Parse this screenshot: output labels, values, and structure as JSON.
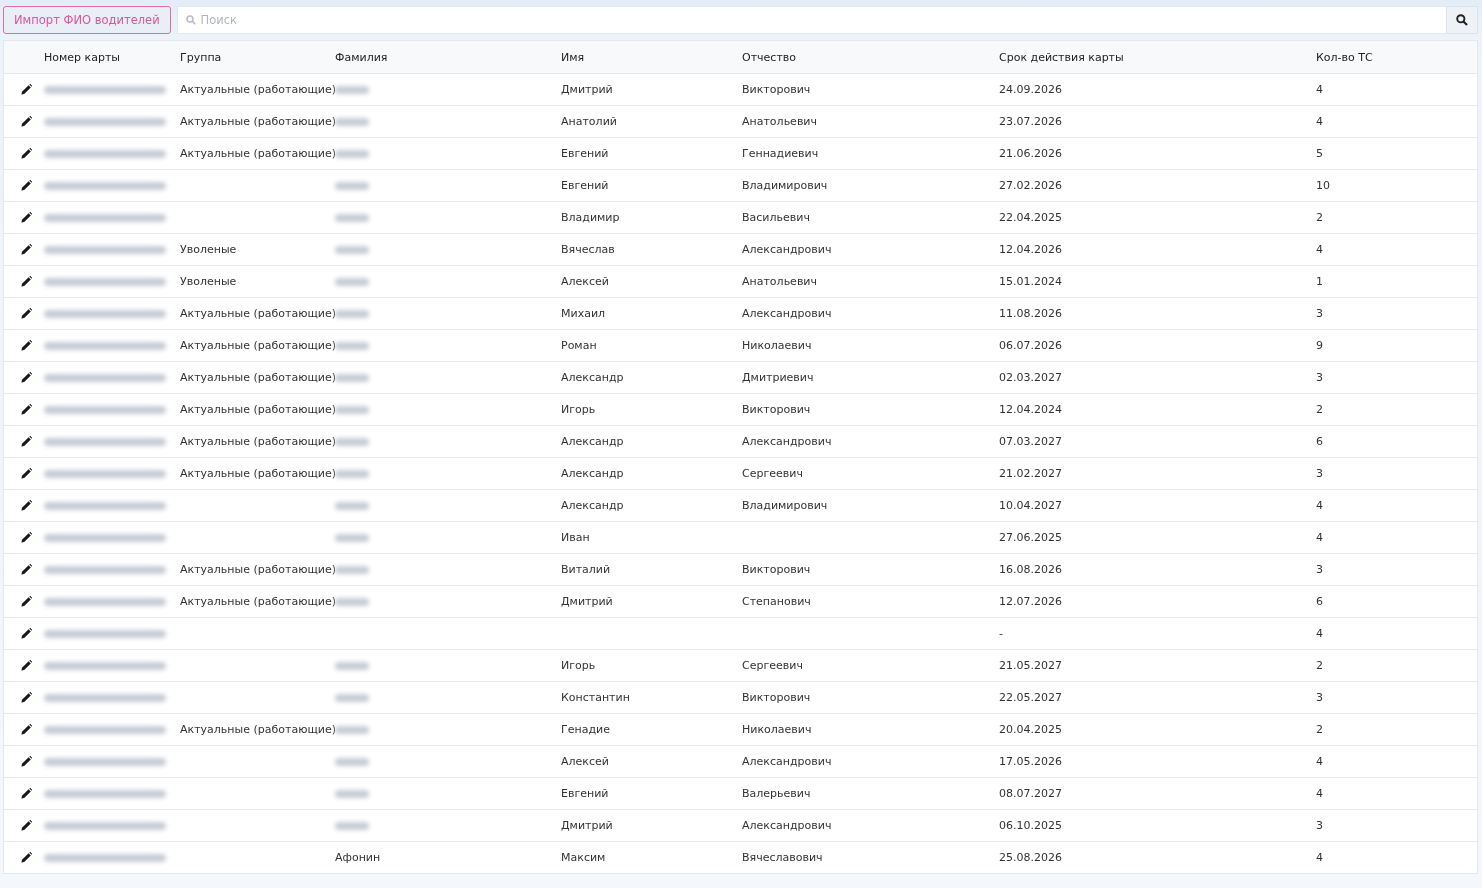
{
  "toolbar": {
    "import_button": "Импорт ФИО водителей",
    "search": {
      "placeholder": "Поиск"
    }
  },
  "table": {
    "columns": [
      "Номер карты",
      "Группа",
      "Фамилия",
      "Имя",
      "Отчество",
      "Срок действия карты",
      "Кол-во ТС"
    ],
    "rows": [
      {
        "card_redacted": true,
        "group": "Актуальные (работающие)",
        "surname_redacted": true,
        "name": "Дмитрий",
        "patronymic": "Викторович",
        "expires": "24.09.2026",
        "vehicles": "4"
      },
      {
        "card_redacted": true,
        "group": "Актуальные (работающие)",
        "surname_redacted": true,
        "name": "Анатолий",
        "patronymic": "Анатольевич",
        "expires": "23.07.2026",
        "vehicles": "4"
      },
      {
        "card_redacted": true,
        "group": "Актуальные (работающие)",
        "surname_redacted": true,
        "name": "Евгений",
        "patronymic": "Геннадиевич",
        "expires": "21.06.2026",
        "vehicles": "5"
      },
      {
        "card_redacted": true,
        "surname_redacted": true,
        "name": "Евгений",
        "patronymic": "Владимирович",
        "expires": "27.02.2026",
        "vehicles": "10"
      },
      {
        "card_redacted": true,
        "surname_redacted": true,
        "name": "Владимир",
        "patronymic": "Васильевич",
        "expires": "22.04.2025",
        "vehicles": "2"
      },
      {
        "card_redacted": true,
        "group": "Уволеные",
        "surname_redacted": true,
        "name": "Вячеслав",
        "patronymic": "Александрович",
        "expires": "12.04.2026",
        "vehicles": "4"
      },
      {
        "card_redacted": true,
        "group": "Уволеные",
        "surname_redacted": true,
        "name": "Алексей",
        "patronymic": "Анатольевич",
        "expires": "15.01.2024",
        "vehicles": "1"
      },
      {
        "card_redacted": true,
        "group": "Актуальные (работающие)",
        "surname_redacted": true,
        "name": "Михаил",
        "patronymic": "Александрович",
        "expires": "11.08.2026",
        "vehicles": "3"
      },
      {
        "card_redacted": true,
        "group": "Актуальные (работающие)",
        "surname_redacted": true,
        "name": "Роман",
        "patronymic": "Николаевич",
        "expires": "06.07.2026",
        "vehicles": "9"
      },
      {
        "card_redacted": true,
        "group": "Актуальные (работающие)",
        "surname_redacted": true,
        "name": "Александр",
        "patronymic": "Дмитриевич",
        "expires": "02.03.2027",
        "vehicles": "3"
      },
      {
        "card_redacted": true,
        "group": "Актуальные (работающие)",
        "surname_redacted": true,
        "name": "Игорь",
        "patronymic": "Викторович",
        "expires": "12.04.2024",
        "vehicles": "2"
      },
      {
        "card_redacted": true,
        "group": "Актуальные (работающие)",
        "surname_redacted": true,
        "name": "Александр",
        "patronymic": "Александрович",
        "expires": "07.03.2027",
        "vehicles": "6"
      },
      {
        "card_redacted": true,
        "group": "Актуальные (работающие)",
        "surname_redacted": true,
        "name": "Александр",
        "patronymic": "Сергеевич",
        "expires": "21.02.2027",
        "vehicles": "3"
      },
      {
        "card_redacted": true,
        "surname_redacted": true,
        "name": "Александр",
        "patronymic": "Владимирович",
        "expires": "10.04.2027",
        "vehicles": "4"
      },
      {
        "card_redacted": true,
        "surname_redacted": true,
        "name": "Иван",
        "expires": "27.06.2025",
        "vehicles": "4"
      },
      {
        "card_redacted": true,
        "group": "Актуальные (работающие)",
        "surname_redacted": true,
        "name": "Виталий",
        "patronymic": "Викторович",
        "expires": "16.08.2026",
        "vehicles": "3"
      },
      {
        "card_redacted": true,
        "group": "Актуальные (работающие)",
        "surname_redacted": true,
        "name": "Дмитрий",
        "patronymic": "Степанович",
        "expires": "12.07.2026",
        "vehicles": "6"
      },
      {
        "card_redacted": true,
        "expires": "-",
        "vehicles": "4"
      },
      {
        "card_redacted": true,
        "surname_redacted": true,
        "name": "Игорь",
        "patronymic": "Сергеевич",
        "expires": "21.05.2027",
        "vehicles": "2"
      },
      {
        "card_redacted": true,
        "surname_redacted": true,
        "name": "Константин",
        "patronymic": "Викторович",
        "expires": "22.05.2027",
        "vehicles": "3"
      },
      {
        "card_redacted": true,
        "group": "Актуальные (работающие)",
        "surname_redacted": true,
        "name": "Генадие",
        "patronymic": "Николаевич",
        "expires": "20.04.2025",
        "vehicles": "2"
      },
      {
        "card_redacted": true,
        "surname_redacted": true,
        "name": "Алексей",
        "patronymic": "Александрович",
        "expires": "17.05.2026",
        "vehicles": "4"
      },
      {
        "card_redacted": true,
        "surname_redacted": true,
        "name": "Евгений",
        "patronymic": "Валерьевич",
        "expires": "08.07.2027",
        "vehicles": "4"
      },
      {
        "card_redacted": true,
        "surname_redacted": true,
        "name": "Дмитрий",
        "patronymic": "Александрович",
        "expires": "06.10.2025",
        "vehicles": "3"
      },
      {
        "card_redacted": true,
        "surname": "Афонин",
        "name": "Максим",
        "patronymic": "Вячеславович",
        "expires": "25.08.2026",
        "vehicles": "4"
      }
    ]
  }
}
